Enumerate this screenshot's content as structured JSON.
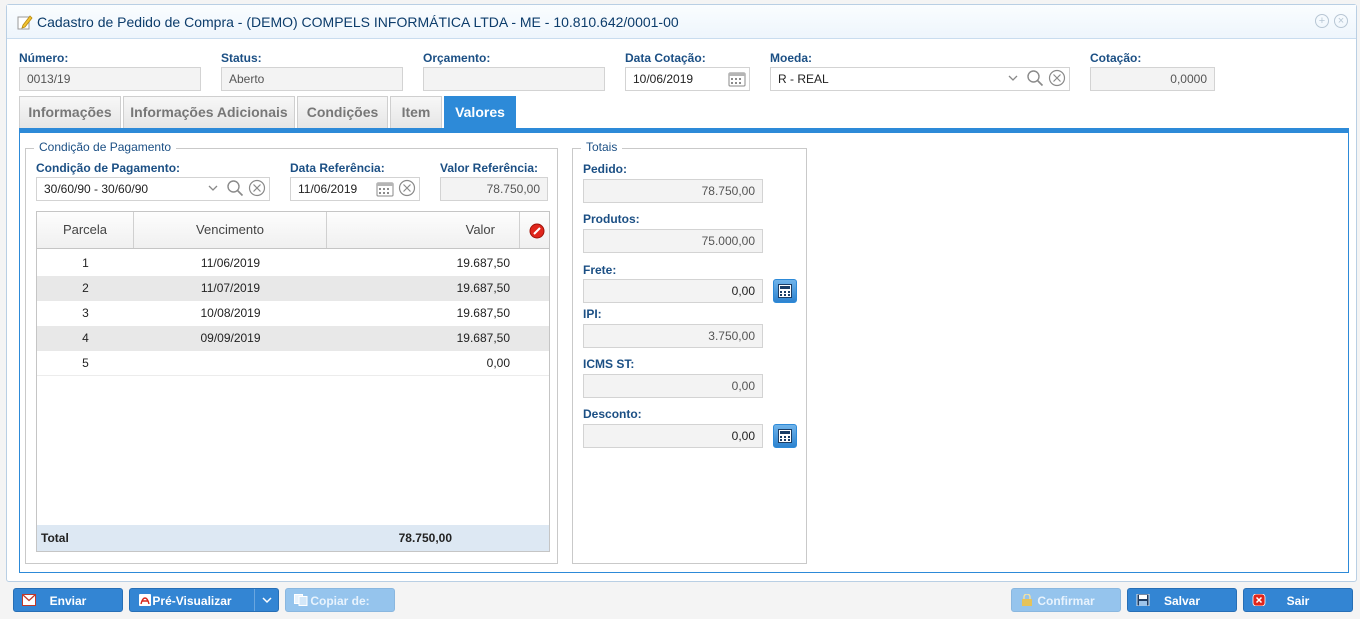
{
  "window": {
    "title": "Cadastro de Pedido de Compra - (DEMO) COMPELS INFORMÁTICA LTDA - ME - 10.810.642/0001-00"
  },
  "header": {
    "numero": {
      "label": "Número:",
      "value": "0013/19"
    },
    "status": {
      "label": "Status:",
      "value": "Aberto"
    },
    "orcamento": {
      "label": "Orçamento:",
      "value": ""
    },
    "data_cotacao": {
      "label": "Data Cotação:",
      "value": "10/06/2019"
    },
    "moeda": {
      "label": "Moeda:",
      "value": "R - REAL"
    },
    "cotacao": {
      "label": "Cotação:",
      "value": "0,0000"
    }
  },
  "tabs": [
    {
      "label": "Informações"
    },
    {
      "label": "Informações Adicionais"
    },
    {
      "label": "Condições"
    },
    {
      "label": "Item"
    },
    {
      "label": "Valores",
      "active": true
    }
  ],
  "pagamento": {
    "legend": "Condição de Pagamento",
    "condicao": {
      "label": "Condição de Pagamento:",
      "value": "30/60/90 - 30/60/90"
    },
    "data_ref": {
      "label": "Data Referência:",
      "value": "11/06/2019"
    },
    "valor_ref": {
      "label": "Valor Referência:",
      "value": "78.750,00"
    },
    "grid": {
      "columns": [
        "Parcela",
        "Vencimento",
        "Valor"
      ],
      "rows": [
        {
          "parcela": "1",
          "vencimento": "11/06/2019",
          "valor": "19.687,50"
        },
        {
          "parcela": "2",
          "vencimento": "11/07/2019",
          "valor": "19.687,50"
        },
        {
          "parcela": "3",
          "vencimento": "10/08/2019",
          "valor": "19.687,50"
        },
        {
          "parcela": "4",
          "vencimento": "09/09/2019",
          "valor": "19.687,50"
        },
        {
          "parcela": "5",
          "vencimento": "",
          "valor": "0,00"
        }
      ],
      "total_label": "Total",
      "total_value": "78.750,00"
    }
  },
  "totais": {
    "legend": "Totais",
    "pedido": {
      "label": "Pedido:",
      "value": "78.750,00"
    },
    "produtos": {
      "label": "Produtos:",
      "value": "75.000,00"
    },
    "frete": {
      "label": "Frete:",
      "value": "0,00"
    },
    "ipi": {
      "label": "IPI:",
      "value": "3.750,00"
    },
    "icms_st": {
      "label": "ICMS ST:",
      "value": "0,00"
    },
    "desconto": {
      "label": "Desconto:",
      "value": "0,00"
    }
  },
  "buttons": {
    "enviar": "Enviar",
    "pre_visualizar": "Pré-Visualizar",
    "copiar": "Copiar de:",
    "confirmar": "Confirmar",
    "salvar": "Salvar",
    "sair": "Sair"
  },
  "colors": {
    "accent": "#2d8ad8",
    "label": "#1b4f84",
    "title": "#0c3c6b"
  }
}
